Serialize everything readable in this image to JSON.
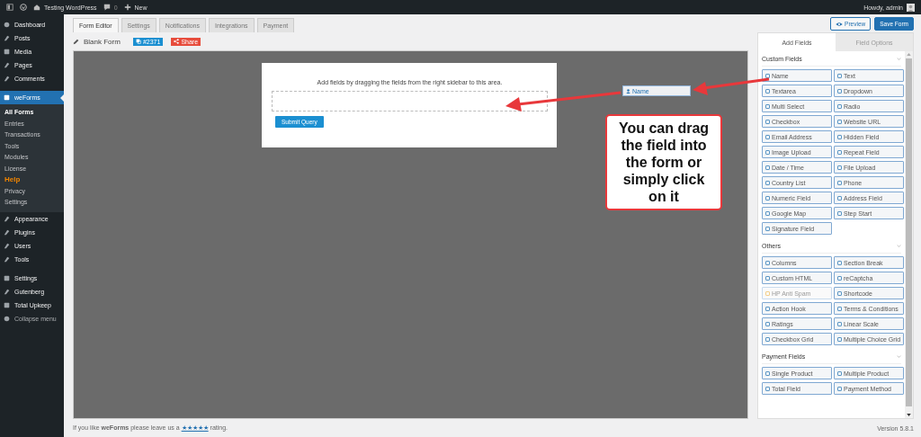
{
  "admin_bar": {
    "site": "Testing WordPress",
    "comments": "0",
    "new": "New",
    "greeting": "Howdy, admin"
  },
  "sidebar": {
    "items": [
      {
        "label": "Dashboard",
        "selected": false
      },
      {
        "label": "Posts",
        "selected": false
      },
      {
        "label": "Media",
        "selected": false
      },
      {
        "label": "Pages",
        "selected": false
      },
      {
        "label": "Comments",
        "selected": false
      },
      {
        "label": "weForms",
        "selected": true,
        "children": [
          {
            "label": "All Forms",
            "selected": true
          },
          {
            "label": "Entries",
            "selected": false
          },
          {
            "label": "Transactions",
            "selected": false
          },
          {
            "label": "Tools",
            "selected": false
          },
          {
            "label": "Modules",
            "selected": false
          },
          {
            "label": "License",
            "selected": false
          },
          {
            "label": "Help",
            "selected": false,
            "color": "#f18500"
          },
          {
            "label": "Privacy",
            "selected": false
          },
          {
            "label": "Settings",
            "selected": false
          }
        ]
      },
      {
        "label": "Appearance",
        "selected": false
      },
      {
        "label": "Plugins",
        "selected": false
      },
      {
        "label": "Users",
        "selected": false
      },
      {
        "label": "Tools",
        "selected": false
      },
      {
        "label": "Settings",
        "selected": false
      },
      {
        "label": "Gutenberg",
        "selected": false
      },
      {
        "label": "Total Upkeep",
        "selected": false
      },
      {
        "label": "Collapse menu",
        "selected": false
      }
    ]
  },
  "tabs": [
    {
      "label": "Form Editor",
      "selected": true
    },
    {
      "label": "Settings",
      "selected": false
    },
    {
      "label": "Notifications",
      "selected": false
    },
    {
      "label": "Integrations",
      "selected": false
    },
    {
      "label": "Payment",
      "selected": false
    }
  ],
  "actions": {
    "preview": "Preview",
    "save": "Save Form"
  },
  "form": {
    "title": "Blank Form",
    "id_badge": "#2371",
    "share": "Share",
    "hint": "Add fields by dragging the fields from the right sidebar to this area.",
    "submit": "Submit Query"
  },
  "dragged_field": "Name",
  "callout": "You can drag the field into the form or simply click on it",
  "panel": {
    "tabs": [
      {
        "label": "Add Fields",
        "selected": true
      },
      {
        "label": "Field Options",
        "selected": false
      }
    ],
    "sections": [
      {
        "title": "Custom Fields",
        "fields": [
          {
            "label": "Name",
            "disabled": false
          },
          {
            "label": "Text",
            "disabled": false
          },
          {
            "label": "Textarea",
            "disabled": false
          },
          {
            "label": "Dropdown",
            "disabled": false
          },
          {
            "label": "Multi Select",
            "disabled": false
          },
          {
            "label": "Radio",
            "disabled": false
          },
          {
            "label": "Checkbox",
            "disabled": false
          },
          {
            "label": "Website URL",
            "disabled": false
          },
          {
            "label": "Email Address",
            "disabled": false
          },
          {
            "label": "Hidden Field",
            "disabled": false
          },
          {
            "label": "Image Upload",
            "disabled": false
          },
          {
            "label": "Repeat Field",
            "disabled": false
          },
          {
            "label": "Date / Time",
            "disabled": false
          },
          {
            "label": "File Upload",
            "disabled": false
          },
          {
            "label": "Country List",
            "disabled": false
          },
          {
            "label": "Phone",
            "disabled": false
          },
          {
            "label": "Numeric Field",
            "disabled": false
          },
          {
            "label": "Address Field",
            "disabled": false
          },
          {
            "label": "Google Map",
            "disabled": false
          },
          {
            "label": "Step Start",
            "disabled": false
          },
          {
            "label": "Signature Field",
            "disabled": false
          }
        ]
      },
      {
        "title": "Others",
        "fields": [
          {
            "label": "Columns",
            "disabled": false
          },
          {
            "label": "Section Break",
            "disabled": false
          },
          {
            "label": "Custom HTML",
            "disabled": false
          },
          {
            "label": "reCaptcha",
            "disabled": false
          },
          {
            "label": "HP Anti Spam",
            "disabled": true
          },
          {
            "label": "Shortcode",
            "disabled": false
          },
          {
            "label": "Action Hook",
            "disabled": false
          },
          {
            "label": "Terms & Conditions",
            "disabled": false
          },
          {
            "label": "Ratings",
            "disabled": false
          },
          {
            "label": "Linear Scale",
            "disabled": false
          },
          {
            "label": "Checkbox Grid",
            "disabled": false
          },
          {
            "label": "Multiple Choice Grid",
            "disabled": false
          }
        ]
      },
      {
        "title": "Payment Fields",
        "fields": [
          {
            "label": "Single Product",
            "disabled": false
          },
          {
            "label": "Multiple Product",
            "disabled": false
          },
          {
            "label": "Total Field",
            "disabled": false
          },
          {
            "label": "Payment Method",
            "disabled": false
          }
        ]
      }
    ]
  },
  "footer": {
    "before": "If you like **weForms** please leave us a",
    "link": "★★★★★",
    "after": "rating.",
    "version": "Version 5.8.1"
  }
}
